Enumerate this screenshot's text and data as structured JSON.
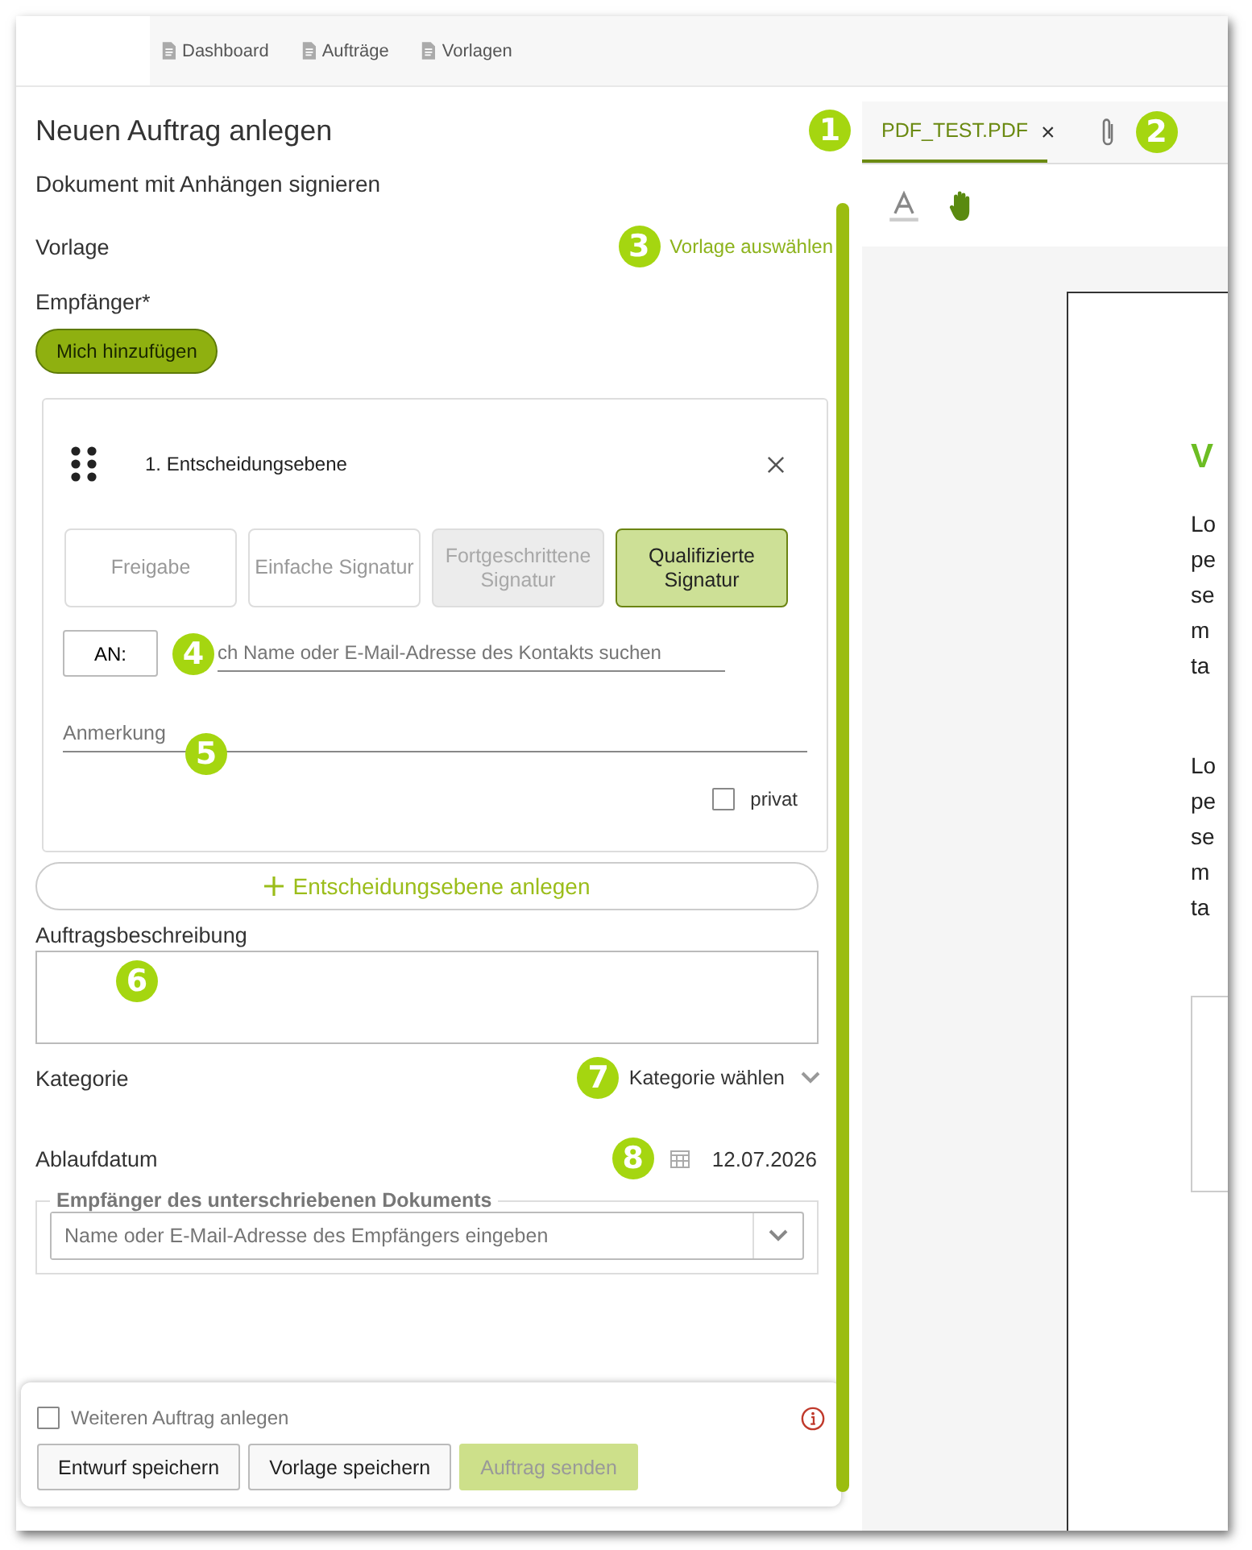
{
  "nav": {
    "items": [
      {
        "label": "Dashboard"
      },
      {
        "label": "Aufträge"
      },
      {
        "label": "Vorlagen"
      }
    ]
  },
  "form": {
    "title": "Neuen Auftrag anlegen",
    "subtitle": "Dokument mit Anhängen signieren",
    "template_label": "Vorlage",
    "template_link": "Vorlage auswählen",
    "recipients_label": "Empfänger*",
    "add_me_button": "Mich hinzufügen",
    "level": {
      "title": "1. Entscheidungsebene",
      "options": [
        {
          "label": "Freigabe",
          "selected": false,
          "disabled": false
        },
        {
          "label": "Einfache Signatur",
          "selected": false,
          "disabled": false
        },
        {
          "label": "Fortgeschrittene Signatur",
          "selected": false,
          "disabled": true
        },
        {
          "label": "Qualifizierte Signatur",
          "selected": true,
          "disabled": false
        }
      ],
      "to_button": "AN:",
      "search_placeholder": "ch Name oder E-Mail-Adresse des Kontakts suchen",
      "note_placeholder": "Anmerkung",
      "private": {
        "label": "privat",
        "checked": false
      }
    },
    "add_level_button": "Entscheidungsebene anlegen",
    "description_label": "Auftragsbeschreibung",
    "category_label": "Kategorie",
    "category_select": "Kategorie wählen",
    "expiry_label": "Ablaufdatum",
    "expiry_date": "12.07.2026",
    "recipient_group": {
      "legend": "Empfänger des unterschriebenen Dokuments",
      "placeholder": "Name oder E-Mail-Adresse des Empfängers eingeben"
    }
  },
  "footer": {
    "another_order": {
      "label": "Weiteren Auftrag anlegen",
      "checked": false
    },
    "buttons": [
      {
        "label": "Entwurf speichern",
        "disabled": false
      },
      {
        "label": "Vorlage speichern",
        "disabled": false
      },
      {
        "label": "Auftrag senden",
        "disabled": true
      }
    ]
  },
  "viewer": {
    "tab": {
      "label": "PDF_TEST.PDF",
      "selected": true
    },
    "tab_close": "×",
    "page": {
      "heading": "V",
      "paragraphs": [
        [
          "Lo",
          "pe",
          "se",
          "m",
          "ta"
        ],
        [
          "Lo",
          "pe",
          "se",
          "m",
          "ta"
        ]
      ]
    }
  },
  "callouts": [
    "1",
    "2",
    "3",
    "4",
    "5",
    "6",
    "7",
    "8"
  ]
}
